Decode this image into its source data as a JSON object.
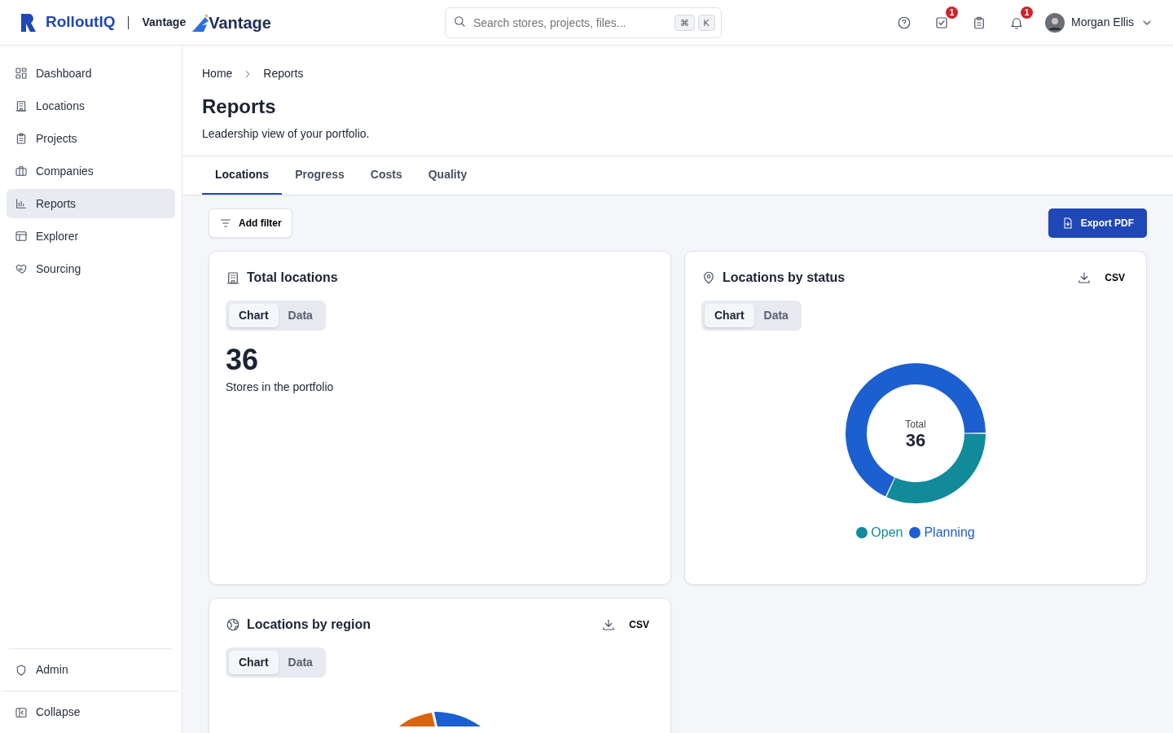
{
  "brand": {
    "name": "RolloutIQ",
    "product": "Vantage",
    "logo_text": "Vantage"
  },
  "search": {
    "placeholder": "Search stores, projects, files...",
    "keys": [
      "⌘",
      "K"
    ]
  },
  "header_icons": [
    {
      "kind": "help"
    },
    {
      "kind": "tasks",
      "badge": "1"
    },
    {
      "kind": "clipboard"
    },
    {
      "kind": "bell",
      "badge": "1"
    }
  ],
  "user": {
    "name": "Morgan Ellis"
  },
  "sidebar": {
    "items": [
      {
        "kind": "dashboard",
        "label": "Dashboard",
        "selected": false
      },
      {
        "kind": "building",
        "label": "Locations",
        "selected": false
      },
      {
        "kind": "clipboard",
        "label": "Projects",
        "selected": false
      },
      {
        "kind": "briefcase",
        "label": "Companies",
        "selected": false
      },
      {
        "kind": "chart",
        "label": "Reports",
        "selected": true
      },
      {
        "kind": "table",
        "label": "Explorer",
        "selected": false
      },
      {
        "kind": "handshake",
        "label": "Sourcing",
        "selected": false
      }
    ],
    "footer": [
      {
        "kind": "shield",
        "label": "Admin"
      },
      {
        "kind": "collapse",
        "label": "Collapse"
      }
    ]
  },
  "breadcrumb": [
    "Home",
    "Reports"
  ],
  "page": {
    "title": "Reports",
    "subtitle": "Leadership view of your portfolio."
  },
  "tabs": [
    {
      "label": "Locations",
      "selected": true
    },
    {
      "label": "Progress",
      "selected": false
    },
    {
      "label": "Costs",
      "selected": false
    },
    {
      "label": "Quality",
      "selected": false
    }
  ],
  "toolbar": {
    "filter": "Add filter",
    "export": "Export PDF"
  },
  "cards": [
    {
      "kind": "stat",
      "title": "Total locations",
      "toggle": [
        {
          "label": "Chart",
          "selected": true
        },
        {
          "label": "Data",
          "selected": false
        }
      ],
      "value": "36",
      "caption": "Stores in the portfolio"
    },
    {
      "kind": "donut",
      "title": "Locations by status",
      "csv": "CSV",
      "toggle": [
        {
          "label": "Chart",
          "selected": true
        },
        {
          "label": "Data",
          "selected": false
        }
      ],
      "center_label": "Total",
      "center_value": "36",
      "legend": [
        {
          "label": "Open",
          "color": "#118a99"
        },
        {
          "label": "Planning",
          "color": "#1b5fd1"
        }
      ]
    },
    {
      "kind": "pie",
      "title": "Locations by region",
      "csv": "CSV",
      "toggle": [
        {
          "label": "Chart",
          "selected": true
        },
        {
          "label": "Data",
          "selected": false
        }
      ]
    }
  ]
}
